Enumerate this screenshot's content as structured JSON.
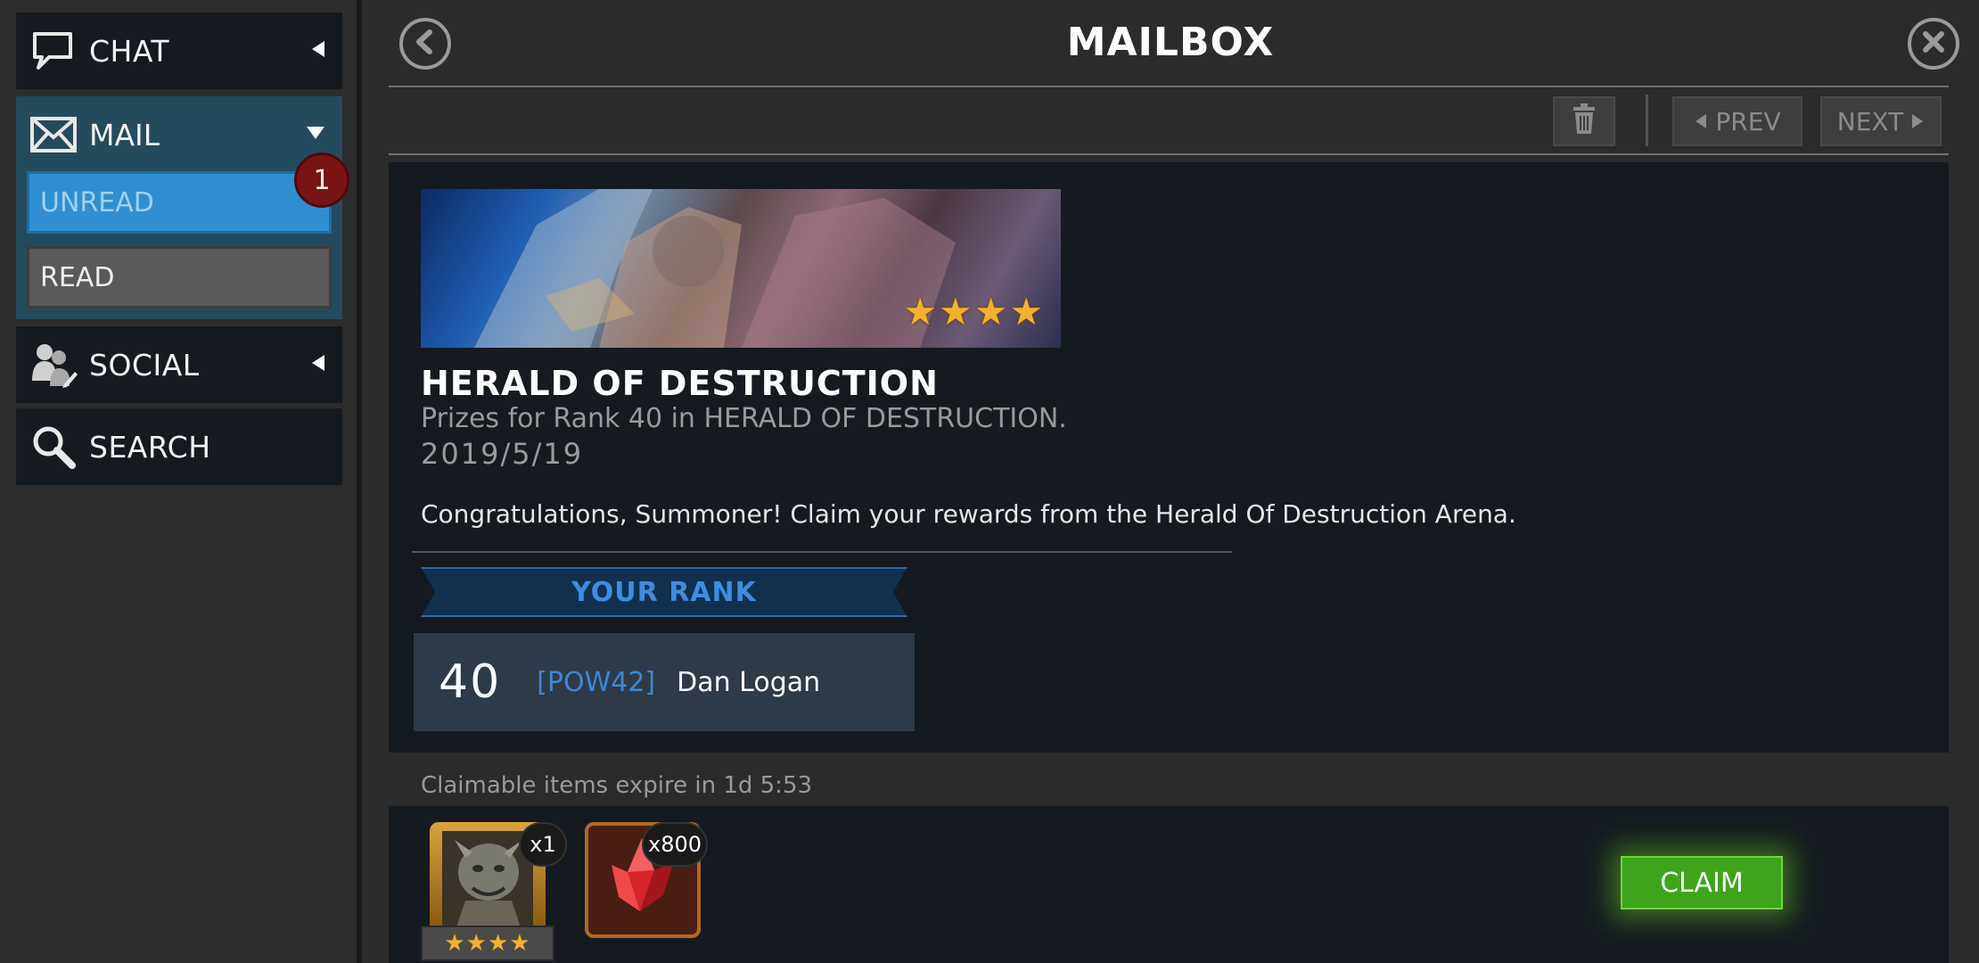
{
  "sidebar": {
    "chat_label": "CHAT",
    "mail_label": "MAIL",
    "unread_label": "UNREAD",
    "read_label": "READ",
    "unread_badge": "1",
    "social_label": "SOCIAL",
    "search_label": "SEARCH"
  },
  "header": {
    "title": "MAILBOX"
  },
  "toolbar": {
    "prev_label": "PREV",
    "next_label": "NEXT"
  },
  "mail": {
    "banner_stars": "★★★★",
    "title": "HERALD OF DESTRUCTION",
    "subtitle": "Prizes for Rank 40 in HERALD OF DESTRUCTION.",
    "date": "2019/5/19",
    "body": "Congratulations, Summoner! Claim your rewards from the Herald Of Destruction Arena.",
    "rank_header": "YOUR RANK",
    "rank": {
      "number": "40",
      "tag": "[POW42]",
      "name": "Dan Logan"
    }
  },
  "rewards": {
    "expire_text": "Claimable items expire in 1d 5:53",
    "items": [
      {
        "icon": "champion-portrait-icon",
        "count": "x1",
        "stars": "★★★★"
      },
      {
        "icon": "red-crystal-icon",
        "count": "x800"
      }
    ],
    "claim_label": "CLAIM"
  },
  "colors": {
    "accent": "#2f8fd0",
    "claim": "#3da41c",
    "badge": "#7a1414"
  }
}
